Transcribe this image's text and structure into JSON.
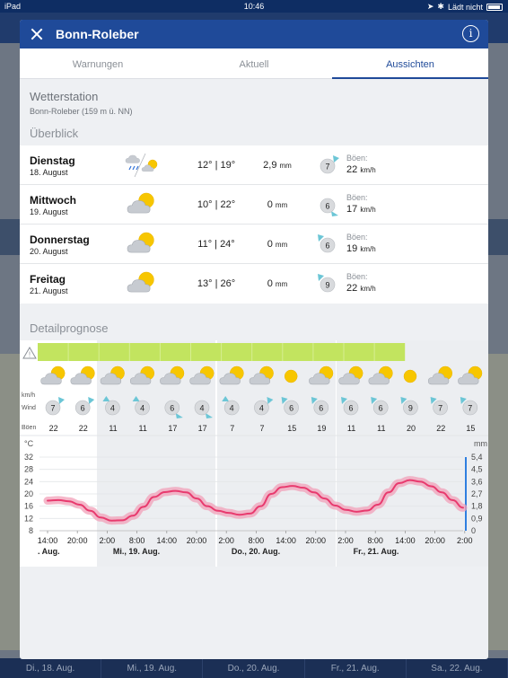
{
  "status": {
    "carrier": "iPad",
    "time": "10:46",
    "battery_text": "Lädt nicht"
  },
  "background": {
    "bottom_days": [
      "Di., 18. Aug.",
      "Mi., 19. Aug.",
      "Do., 20. Aug.",
      "Fr., 21. Aug.",
      "Sa., 22. Aug."
    ]
  },
  "modal": {
    "title": "Bonn-Roleber",
    "tabs": [
      {
        "label": "Warnungen",
        "active": false
      },
      {
        "label": "Aktuell",
        "active": false
      },
      {
        "label": "Aussichten",
        "active": true
      }
    ],
    "station_title": "Wetterstation",
    "station_sub": "Bonn-Roleber (159 m ü. NN)",
    "overview_title": "Überblick",
    "days": [
      {
        "name": "Dienstag",
        "date": "18. August",
        "icon": "rain-sun-split-icon",
        "temp": "12° | 19°",
        "rain_value": "2,9",
        "rain_unit": "mm",
        "wind": "7",
        "gust_label": "Böen:",
        "gust_value": "22",
        "gust_unit": "km/h"
      },
      {
        "name": "Mittwoch",
        "date": "19. August",
        "icon": "cloud-sun-icon",
        "temp": "10° | 22°",
        "rain_value": "0",
        "rain_unit": "mm",
        "wind": "6",
        "gust_label": "Böen:",
        "gust_value": "17",
        "gust_unit": "km/h"
      },
      {
        "name": "Donnerstag",
        "date": "20. August",
        "icon": "cloud-sun-icon",
        "temp": "11° | 24°",
        "rain_value": "0",
        "rain_unit": "mm",
        "wind": "6",
        "gust_label": "Böen:",
        "gust_value": "19",
        "gust_unit": "km/h"
      },
      {
        "name": "Freitag",
        "date": "21. August",
        "icon": "cloud-sun-icon",
        "temp": "13° | 26°",
        "rain_value": "0",
        "rain_unit": "mm",
        "wind": "9",
        "gust_label": "Böen:",
        "gust_value": "22",
        "gust_unit": "km/h"
      }
    ],
    "detail_title": "Detailprognose",
    "detail": {
      "wind_unit_label": "km/h",
      "wind_label": "Wind",
      "gust_label": "Böen",
      "icons": [
        "cloud-sun",
        "cloud-sun",
        "cloud-sun",
        "cloud-sun",
        "cloud-sun",
        "cloud-sun",
        "cloud-sun",
        "cloud-sun",
        "sun",
        "cloud-sun",
        "cloud-sun",
        "cloud-sun",
        "sun",
        "cloud-sun",
        "cloud-sun"
      ],
      "wind": [
        "7",
        "6",
        "4",
        "4",
        "6",
        "4",
        "4",
        "4",
        "6",
        "6",
        "6",
        "6",
        "9",
        "7",
        "7"
      ],
      "gusts": [
        "22",
        "22",
        "11",
        "11",
        "17",
        "17",
        "7",
        "7",
        "15",
        "19",
        "11",
        "11",
        "20",
        "22",
        "15"
      ],
      "warning_hours": 12
    },
    "colors": {
      "header": "#1f4a99",
      "warning_bar": "#c2e45f",
      "temp_line": "#e83a6e",
      "temp_band": "#f2a0b8",
      "rain_axis": "#2f7fe0"
    }
  },
  "chart_data": {
    "type": "line",
    "temp_axis_label": "°C",
    "temp_ticks": [
      "32",
      "28",
      "24",
      "20",
      "16",
      "12",
      "8"
    ],
    "rain_axis_label": "mm",
    "rain_ticks": [
      "5,4",
      "4,5",
      "3,6",
      "2,7",
      "1,8",
      "0,9",
      "0"
    ],
    "ylim": [
      8,
      32
    ],
    "x_time_labels": [
      "14:00",
      "20:00",
      "2:00",
      "8:00",
      "14:00",
      "20:00",
      "2:00",
      "8:00",
      "14:00",
      "20:00",
      "2:00",
      "8:00",
      "14:00",
      "20:00",
      "2:00"
    ],
    "x_day_labels": [
      ". Aug.",
      "Mi., 19. Aug.",
      "Do., 20. Aug.",
      "Fr., 21. Aug."
    ],
    "series": [
      {
        "values": [
          17.8,
          18,
          17.6,
          16.5,
          14.5,
          12.3,
          11.3,
          11.4,
          12.9,
          15.8,
          19,
          20.6,
          21,
          20.5,
          18.5,
          16,
          14.5,
          13.8,
          13.2,
          13.6,
          16,
          20,
          22.2,
          22.6,
          22,
          20.5,
          18.5,
          16.2,
          14.8,
          14.2,
          14.6,
          16.5,
          20.5,
          23.5,
          24.5,
          24,
          22.5,
          20.5,
          18,
          15.5
        ]
      }
    ]
  }
}
